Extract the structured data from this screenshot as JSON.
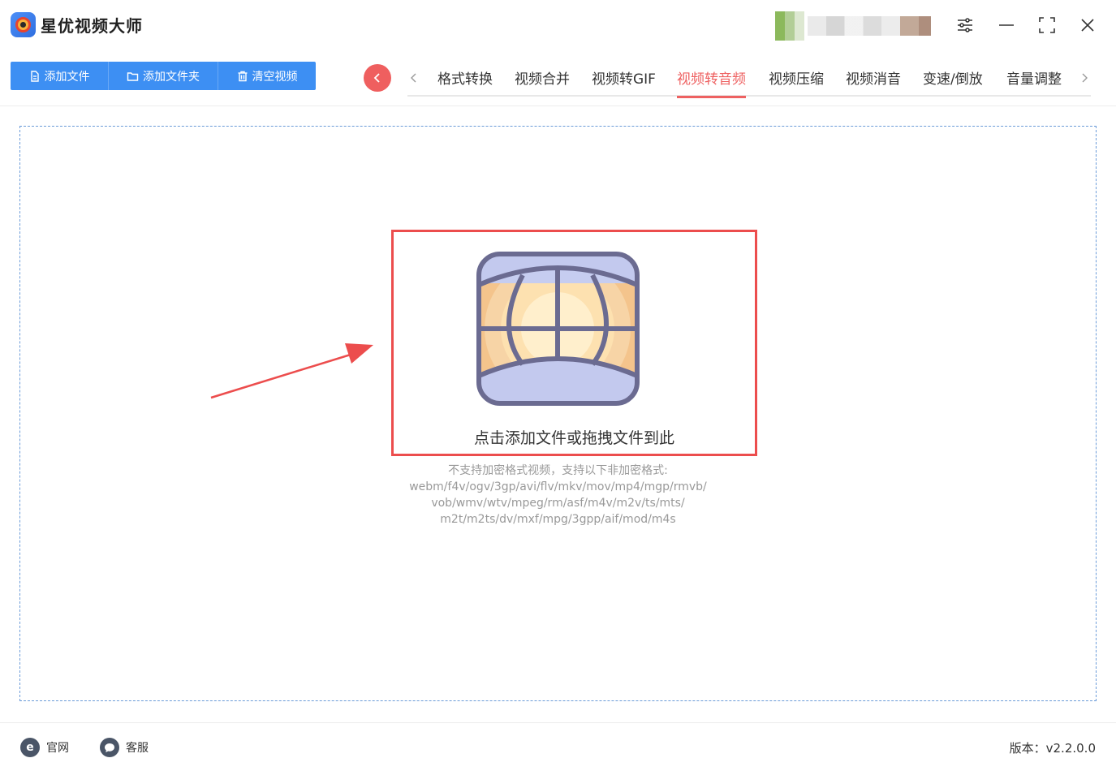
{
  "app": {
    "title": "星优视频大师"
  },
  "toolbar": {
    "add_file": "添加文件",
    "add_folder": "添加文件夹",
    "clear_videos": "清空视频"
  },
  "tabs": [
    {
      "label": "格式转换",
      "active": false
    },
    {
      "label": "视频合并",
      "active": false
    },
    {
      "label": "视频转GIF",
      "active": false
    },
    {
      "label": "视频转音频",
      "active": true
    },
    {
      "label": "视频压缩",
      "active": false
    },
    {
      "label": "视频消音",
      "active": false
    },
    {
      "label": "变速/倒放",
      "active": false
    },
    {
      "label": "音量调整",
      "active": false
    }
  ],
  "dropzone": {
    "label": "点击添加文件或拖拽文件到此",
    "note_lines": [
      "不支持加密格式视频，支持以下非加密格式:",
      "webm/f4v/ogv/3gp/avi/flv/mkv/mov/mp4/mgp/rmvb/",
      "vob/wmv/wtv/mpeg/rm/asf/m4v/m2v/ts/mts/",
      "m2t/m2ts/dv/mxf/mpg/3gpp/aif/mod/m4s"
    ]
  },
  "footer": {
    "website": "官网",
    "support": "客服",
    "version": "版本：v2.2.0.0"
  },
  "icons": {
    "app_logo": "app-logo-icon",
    "settings": "sliders-icon",
    "minimize": "minimize-icon",
    "maximize": "maximize-icon",
    "close": "close-icon",
    "back": "chevron-left-icon",
    "prev": "chevron-left-icon",
    "next": "chevron-right-icon",
    "file": "file-icon",
    "folder": "folder-icon",
    "trash": "trash-icon",
    "website": "ie-icon",
    "support": "chat-icon"
  },
  "colors": {
    "accent": "#3d8ff3",
    "active_tab": "#ee6161",
    "highlight": "#ec4d4d"
  }
}
